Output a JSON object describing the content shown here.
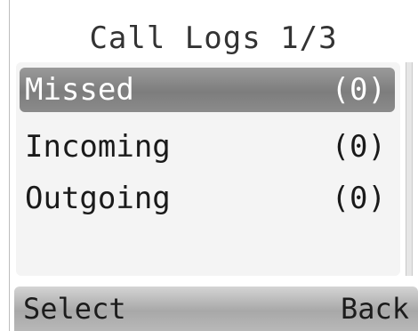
{
  "header": {
    "title": "Call Logs 1/3"
  },
  "menu": {
    "items": [
      {
        "label": "Missed",
        "count": "(0)"
      },
      {
        "label": "Incoming",
        "count": "(0)"
      },
      {
        "label": "Outgoing",
        "count": "(0)"
      }
    ]
  },
  "softkeys": {
    "left": "Select",
    "right": "Back"
  },
  "colors": {
    "highlight": "#8a8a8a",
    "softkey_bar": "#b8b8b8"
  }
}
